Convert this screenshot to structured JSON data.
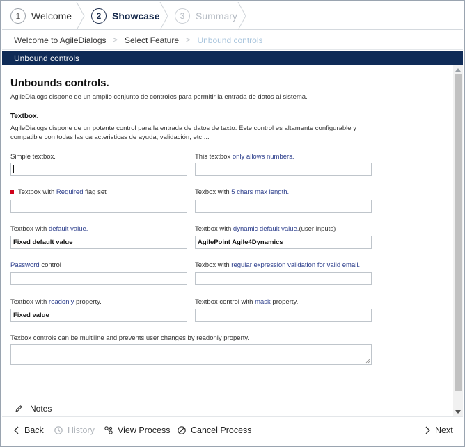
{
  "wizard": {
    "steps": [
      {
        "num": "1",
        "label": "Welcome",
        "state": "done"
      },
      {
        "num": "2",
        "label": "Showcase",
        "state": "active"
      },
      {
        "num": "3",
        "label": "Summary",
        "state": "disabled"
      }
    ]
  },
  "breadcrumb": [
    "Welcome to AgileDialogs",
    "Select Feature",
    "Unbound controls"
  ],
  "titlebar": "Unbound controls",
  "content": {
    "heading": "Unbounds controls.",
    "intro": "AgileDialogs dispone de un amplio conjunto de controles para permitir la entrada de datos al sistema.",
    "section_title": "Textbox.",
    "section_desc": "AgileDialogs dispone de un potente control para la entrada de datos de texto. Este control es altamente configurable y compatible con todas las caracteristicas de ayuda, validación, etc ...",
    "fields": {
      "simple": {
        "label": "Simple textbox.",
        "value": ""
      },
      "numbers": {
        "label_a": "This textbox ",
        "label_b": "only allows numbers.",
        "value": ""
      },
      "required": {
        "label_a": "Textbox with ",
        "label_b": "Required",
        "label_c": " flag set",
        "value": ""
      },
      "maxlen": {
        "label_a": "Texbox with ",
        "label_b": "5 chars max length.",
        "value": ""
      },
      "default": {
        "label_a": "Textbox with ",
        "label_b": "default value.",
        "value": "Fixed default value"
      },
      "dyndefault": {
        "label_a": "Textbox with ",
        "label_b": "dynamic default value.",
        "label_c": "(user inputs)",
        "value": "AgilePoint Agile4Dynamics"
      },
      "password": {
        "label_a": "Password",
        "label_b": " control",
        "value": ""
      },
      "regex": {
        "label_a": "Texbox with ",
        "label_b": "regular expression validation for valid email.",
        "value": ""
      },
      "readonly": {
        "label_a": "Textbox with ",
        "label_b": "readonly",
        "label_c": " property.",
        "value": "Fixed value"
      },
      "mask": {
        "label_a": "Textbox control with ",
        "label_b": "mask",
        "label_c": " property.",
        "value": ""
      },
      "multiline": {
        "label": "Texbox controls can be multiline and prevents user changes by readonly property.",
        "value": ""
      }
    },
    "notes_label": "Notes"
  },
  "footer": {
    "back": "Back",
    "history": "History",
    "view_process": "View Process",
    "cancel_process": "Cancel Process",
    "next": "Next"
  },
  "colors": {
    "titlebar_bg": "#0f2b57",
    "link_text": "#2c3e8c",
    "required_marker": "#d0021b",
    "crumb_current": "#a9c5dd"
  }
}
